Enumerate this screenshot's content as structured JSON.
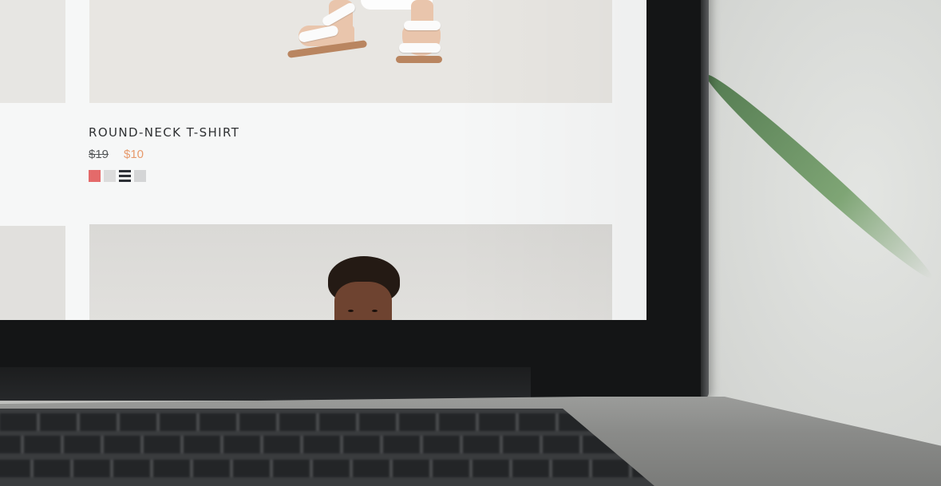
{
  "product": {
    "name": "ROUND-NECK T-SHIRT",
    "price_original": "$19",
    "price_sale": "$10",
    "swatches": [
      {
        "name": "coral",
        "color": "#e46a6a"
      },
      {
        "name": "light-grey",
        "color": "#dcdcdc"
      },
      {
        "name": "striped-navy",
        "color": "#2c2f35"
      },
      {
        "name": "silver-grey",
        "color": "#d4d5d6"
      }
    ]
  },
  "colors": {
    "sale_price": "#e79a6c",
    "text": "#2f3133",
    "screen_bg": "#f6f7f7"
  }
}
